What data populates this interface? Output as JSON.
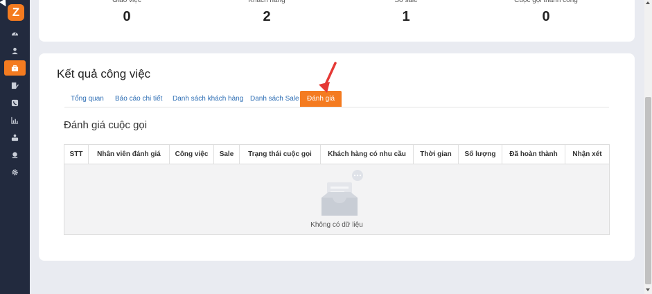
{
  "app": {
    "logo_letter": "Z"
  },
  "sidebar": {
    "items": [
      {
        "icon": "dashboard-icon",
        "active": false
      },
      {
        "icon": "user-icon",
        "active": false
      },
      {
        "icon": "briefcase-icon",
        "active": true
      },
      {
        "icon": "edit-icon",
        "active": false
      },
      {
        "icon": "phone-icon",
        "active": false
      },
      {
        "icon": "chart-icon",
        "active": false
      },
      {
        "icon": "team-icon",
        "active": false
      },
      {
        "icon": "support-icon",
        "active": false
      },
      {
        "icon": "gear-icon",
        "active": false
      }
    ]
  },
  "stats": [
    {
      "label": "Giao việc",
      "value": "0"
    },
    {
      "label": "Khách hàng",
      "value": "2"
    },
    {
      "label": "Số sale",
      "value": "1"
    },
    {
      "label": "Cuộc gọi thành công",
      "value": "0"
    }
  ],
  "main": {
    "title": "Kết quả công việc",
    "tabs": [
      {
        "label": "Tổng quan",
        "active": false
      },
      {
        "label": "Báo cáo chi tiết",
        "active": false
      },
      {
        "label": "Danh sách khách hàng",
        "active": false
      },
      {
        "label": "Danh sách Sale",
        "active": false
      },
      {
        "label": "Đánh giá",
        "active": true
      }
    ],
    "section_title": "Đánh giá cuộc gọi",
    "table": {
      "columns": [
        "STT",
        "Nhân viên đánh giá",
        "Công việc",
        "Sale",
        "Trạng thái cuộc gọi",
        "Khách hàng có nhu cầu",
        "Thời gian",
        "Số lượng",
        "Đã hoàn thành",
        "Nhận xét"
      ],
      "empty_text": "Không có dữ liệu"
    }
  },
  "colors": {
    "accent": "#f47b20",
    "sidebar": "#222a3e",
    "link": "#2f6fb5",
    "arrow": "#e53935"
  }
}
